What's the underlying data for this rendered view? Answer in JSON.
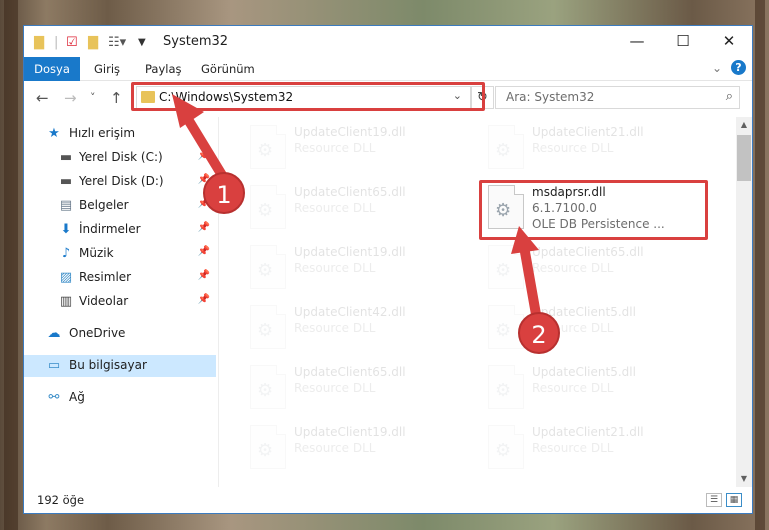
{
  "window": {
    "title": "System32",
    "controls": {
      "minimize": "—",
      "maximize": "☐",
      "close": "✕"
    }
  },
  "ribbon": {
    "tabs": [
      "Dosya",
      "Giriş",
      "Paylaş",
      "Görünüm"
    ],
    "expand_icon": "chevron-down-icon",
    "help": "?"
  },
  "nav": {
    "back": "←",
    "forward": "→",
    "recent": "˅",
    "up": "↑",
    "address_path": "C:\\Windows\\System32",
    "search_placeholder": "Ara: System32"
  },
  "sidebar": {
    "items": [
      {
        "label": "Hızlı erişim",
        "icon": "star-icon"
      },
      {
        "label": "Yerel Disk (C:)",
        "icon": "drive-icon",
        "pinned": true
      },
      {
        "label": "Yerel Disk (D:)",
        "icon": "drive-icon",
        "pinned": true
      },
      {
        "label": "Belgeler",
        "icon": "documents-icon",
        "pinned": true
      },
      {
        "label": "İndirmeler",
        "icon": "download-icon",
        "pinned": true
      },
      {
        "label": "Müzik",
        "icon": "music-icon",
        "pinned": true
      },
      {
        "label": "Resimler",
        "icon": "pictures-icon",
        "pinned": true
      },
      {
        "label": "Videolar",
        "icon": "videos-icon",
        "pinned": true
      },
      {
        "label": "OneDrive",
        "icon": "cloud-icon"
      },
      {
        "label": "Bu bilgisayar",
        "icon": "computer-icon",
        "selected": true
      },
      {
        "label": "Ağ",
        "icon": "network-icon"
      }
    ]
  },
  "files": {
    "col1": [
      {
        "name": "UpdateClient19.dll",
        "desc": "Resource DLL"
      },
      {
        "name": "UpdateClient65.dll",
        "desc": "Resource DLL"
      },
      {
        "name": "UpdateClient19.dll",
        "desc": "Resource DLL"
      },
      {
        "name": "UpdateClient42.dll",
        "desc": "Resource DLL"
      },
      {
        "name": "UpdateClient65.dll",
        "desc": "Resource DLL"
      },
      {
        "name": "UpdateClient19.dll",
        "desc": "Resource DLL"
      }
    ],
    "col2": [
      {
        "name": "UpdateClient21.dll",
        "desc": "Resource DLL"
      },
      {
        "name": "UpdateClient65.dll",
        "desc": "Resource DLL"
      },
      {
        "name": "UpdateClient5.dll",
        "desc": "Resource DLL"
      },
      {
        "name": "UpdateClient5.dll",
        "desc": "Resource DLL"
      },
      {
        "name": "UpdateClient21.dll",
        "desc": "Resource DLL"
      }
    ],
    "highlighted": {
      "name": "msdaprsr.dll",
      "version": "6.1.7100.0",
      "desc": "OLE DB Persistence ..."
    }
  },
  "status": {
    "count": "192 öğe"
  },
  "annotations": {
    "step1": "1",
    "step2": "2",
    "color": "#d9403f"
  }
}
